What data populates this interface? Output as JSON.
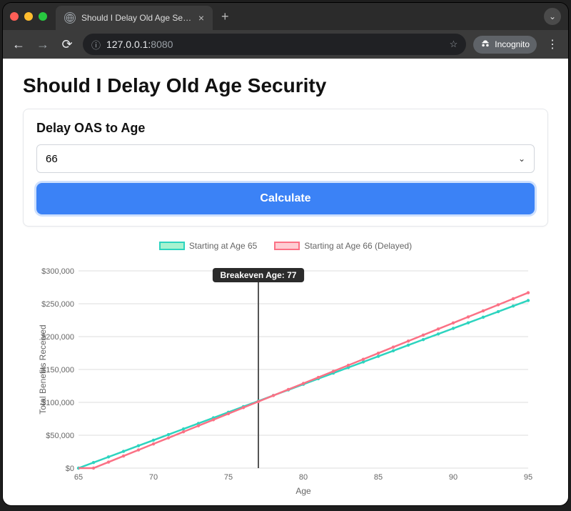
{
  "browser": {
    "tab_title": "Should I Delay Old Age Secur",
    "url_host": "127.0.0.1:",
    "url_port": "8080",
    "incognito_label": "Incognito"
  },
  "page": {
    "title": "Should I Delay Old Age Security",
    "form_label": "Delay OAS to Age",
    "selected_age": "66",
    "button_label": "Calculate"
  },
  "colors": {
    "series_a_stroke": "#2dd4bf",
    "series_a_fill": "#a7f3d0",
    "series_b_stroke": "#fb7185",
    "series_b_fill": "#fecdd3",
    "primary": "#3b82f6"
  },
  "chart_data": {
    "type": "line",
    "xlabel": "Age",
    "ylabel": "Total Benefits Received",
    "legend": [
      "Starting at Age 65",
      "Starting at Age 66 (Delayed)"
    ],
    "x": [
      65,
      66,
      67,
      68,
      69,
      70,
      71,
      72,
      73,
      74,
      75,
      76,
      77,
      78,
      79,
      80,
      81,
      82,
      83,
      84,
      85,
      86,
      87,
      88,
      89,
      90,
      91,
      92,
      93,
      94,
      95
    ],
    "y_ticks": [
      0,
      50000,
      100000,
      150000,
      200000,
      250000,
      300000
    ],
    "y_tick_labels": [
      "$0",
      "$50,000",
      "$100,000",
      "$150,000",
      "$200,000",
      "$250,000",
      "$300,000"
    ],
    "x_tick_labels": [
      "65",
      "70",
      "75",
      "80",
      "85",
      "90",
      "95"
    ],
    "xlim": [
      65,
      95
    ],
    "ylim": [
      0,
      300000
    ],
    "series": [
      {
        "name": "Starting at Age 65",
        "step": 8500,
        "start_x": 65
      },
      {
        "name": "Starting at Age 66 (Delayed)",
        "step": 9200,
        "start_x": 66
      }
    ],
    "annotation": {
      "x": 77,
      "label": "Breakeven Age: 77"
    }
  }
}
